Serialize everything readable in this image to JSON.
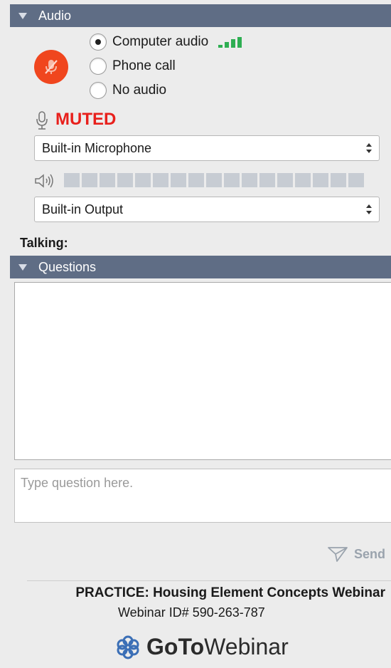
{
  "audio_section": {
    "title": "Audio"
  },
  "audio_options": [
    {
      "label": "Computer audio",
      "selected": true
    },
    {
      "label": "Phone call",
      "selected": false
    },
    {
      "label": "No audio",
      "selected": false
    }
  ],
  "mic_status": {
    "text": "MUTED",
    "color": "#e8201c"
  },
  "microphone_select": {
    "value": "Built-in Microphone"
  },
  "speaker_select": {
    "value": "Built-in Output"
  },
  "talking": {
    "label": "Talking:"
  },
  "questions_section": {
    "title": "Questions"
  },
  "question_input": {
    "placeholder": "Type question here."
  },
  "send": {
    "label": "Send"
  },
  "webinar": {
    "title": "PRACTICE: Housing Element Concepts Webinar",
    "id_text": "Webinar ID# 590-263-787"
  },
  "logo": {
    "part1": "GoTo",
    "part2": "Webinar"
  },
  "colors": {
    "header_bg": "#5f6d85",
    "mute_button": "#f0461e",
    "signal_bars": "#2eae52"
  },
  "icons": [
    "muted-microphone-icon",
    "microphone-icon",
    "speaker-icon",
    "send-icon",
    "gotowebinar-logo-icon",
    "select-arrows-icon"
  ]
}
